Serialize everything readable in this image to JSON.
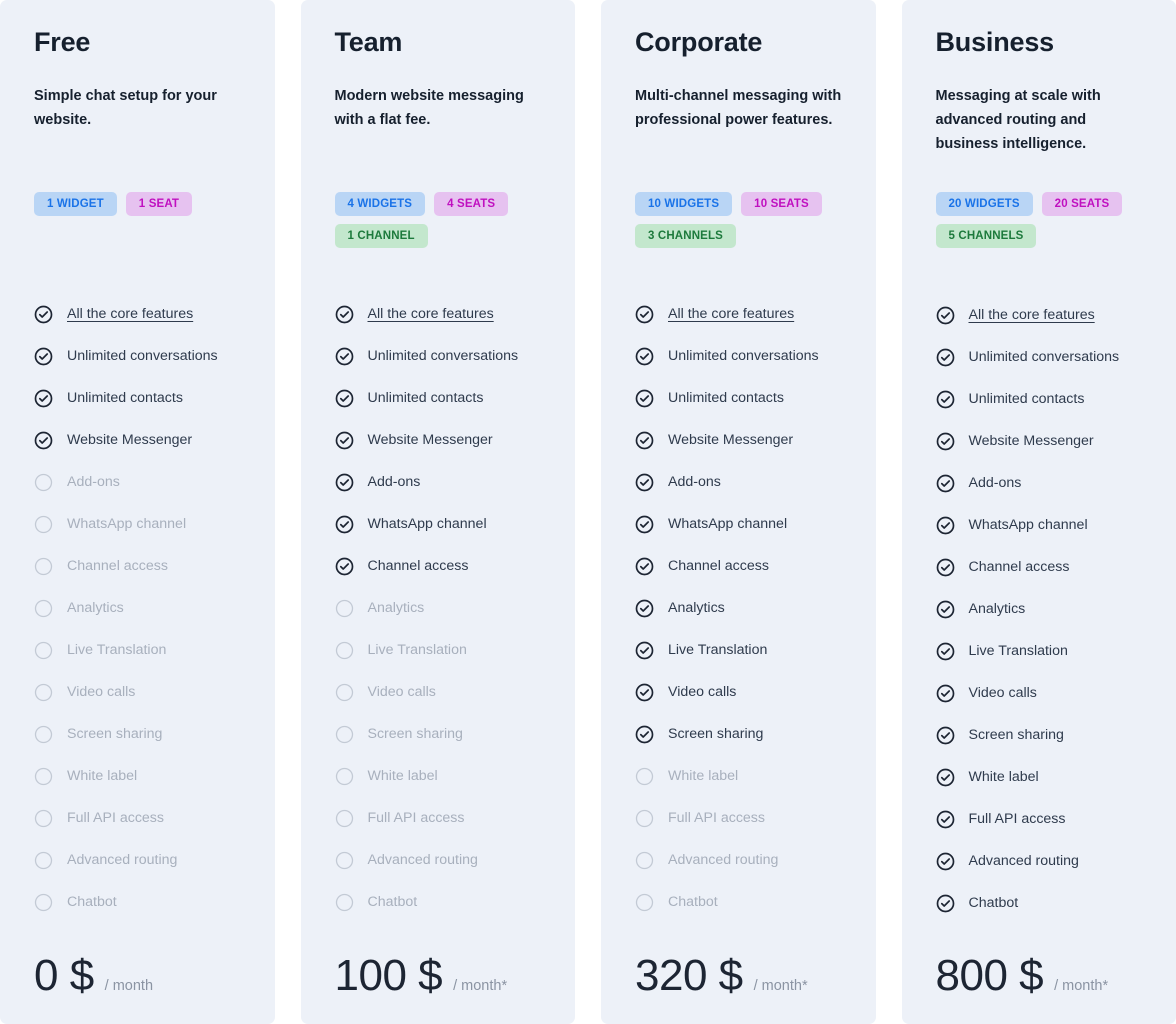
{
  "features": [
    "All the core features",
    "Unlimited conversations",
    "Unlimited contacts",
    "Website Messenger",
    "Add-ons",
    "WhatsApp channel",
    "Channel access",
    "Analytics",
    "Live Translation",
    "Video calls",
    "Screen sharing",
    "White label",
    "Full API access",
    "Advanced routing",
    "Chatbot"
  ],
  "colors": {
    "card_background": "#edf1f8",
    "page_background": "#ffffff",
    "heading": "#16202e",
    "feature_on": "#2f3b4d",
    "feature_off": "#a8b0bd",
    "badge_widgets_bg": "#b9d5f5",
    "badge_widgets_text": "#1a73e8",
    "badge_seats_bg": "#e6c2f0",
    "badge_seats_text": "#c010c0",
    "badge_channels_bg": "#c3e7cd",
    "badge_channels_text": "#1d7a3c",
    "price_amount": "#1d2533",
    "price_period": "#8b94a3"
  },
  "plans": [
    {
      "name": "Free",
      "description": "Simple chat setup for your website.",
      "badges": [
        {
          "label": "1 WIDGET",
          "type": "widgets"
        },
        {
          "label": "1 SEAT",
          "type": "seats"
        }
      ],
      "features": [
        {
          "label": "All the core features",
          "included": true,
          "link": true
        },
        {
          "label": "Unlimited conversations",
          "included": true,
          "link": false
        },
        {
          "label": "Unlimited contacts",
          "included": true,
          "link": false
        },
        {
          "label": "Website Messenger",
          "included": true,
          "link": false
        },
        {
          "label": "Add-ons",
          "included": false,
          "link": false
        },
        {
          "label": "WhatsApp channel",
          "included": false,
          "link": false
        },
        {
          "label": "Channel access",
          "included": false,
          "link": false
        },
        {
          "label": "Analytics",
          "included": false,
          "link": false
        },
        {
          "label": "Live Translation",
          "included": false,
          "link": false
        },
        {
          "label": "Video calls",
          "included": false,
          "link": false
        },
        {
          "label": "Screen sharing",
          "included": false,
          "link": false
        },
        {
          "label": "White label",
          "included": false,
          "link": false
        },
        {
          "label": "Full API access",
          "included": false,
          "link": false
        },
        {
          "label": "Advanced routing",
          "included": false,
          "link": false
        },
        {
          "label": "Chatbot",
          "included": false,
          "link": false
        }
      ],
      "price_amount": "0 $",
      "price_period": "/ month"
    },
    {
      "name": "Team",
      "description": "Modern website messaging with a flat fee.",
      "badges": [
        {
          "label": "4 WIDGETS",
          "type": "widgets"
        },
        {
          "label": "4 SEATS",
          "type": "seats"
        },
        {
          "label": "1 CHANNEL",
          "type": "channels"
        }
      ],
      "features": [
        {
          "label": "All the core features",
          "included": true,
          "link": true
        },
        {
          "label": "Unlimited conversations",
          "included": true,
          "link": false
        },
        {
          "label": "Unlimited contacts",
          "included": true,
          "link": false
        },
        {
          "label": "Website Messenger",
          "included": true,
          "link": false
        },
        {
          "label": "Add-ons",
          "included": true,
          "link": false
        },
        {
          "label": "WhatsApp channel",
          "included": true,
          "link": false
        },
        {
          "label": "Channel access",
          "included": true,
          "link": false
        },
        {
          "label": "Analytics",
          "included": false,
          "link": false
        },
        {
          "label": "Live Translation",
          "included": false,
          "link": false
        },
        {
          "label": "Video calls",
          "included": false,
          "link": false
        },
        {
          "label": "Screen sharing",
          "included": false,
          "link": false
        },
        {
          "label": "White label",
          "included": false,
          "link": false
        },
        {
          "label": "Full API access",
          "included": false,
          "link": false
        },
        {
          "label": "Advanced routing",
          "included": false,
          "link": false
        },
        {
          "label": "Chatbot",
          "included": false,
          "link": false
        }
      ],
      "price_amount": "100 $",
      "price_period": "/ month*"
    },
    {
      "name": "Corporate",
      "description": "Multi-channel messaging with professional power features.",
      "badges": [
        {
          "label": "10 WIDGETS",
          "type": "widgets"
        },
        {
          "label": "10 SEATS",
          "type": "seats"
        },
        {
          "label": "3 CHANNELS",
          "type": "channels"
        }
      ],
      "features": [
        {
          "label": "All the core features",
          "included": true,
          "link": true
        },
        {
          "label": "Unlimited conversations",
          "included": true,
          "link": false
        },
        {
          "label": "Unlimited contacts",
          "included": true,
          "link": false
        },
        {
          "label": "Website Messenger",
          "included": true,
          "link": false
        },
        {
          "label": "Add-ons",
          "included": true,
          "link": false
        },
        {
          "label": "WhatsApp channel",
          "included": true,
          "link": false
        },
        {
          "label": "Channel access",
          "included": true,
          "link": false
        },
        {
          "label": "Analytics",
          "included": true,
          "link": false
        },
        {
          "label": "Live Translation",
          "included": true,
          "link": false
        },
        {
          "label": "Video calls",
          "included": true,
          "link": false
        },
        {
          "label": "Screen sharing",
          "included": true,
          "link": false
        },
        {
          "label": "White label",
          "included": false,
          "link": false
        },
        {
          "label": "Full API access",
          "included": false,
          "link": false
        },
        {
          "label": "Advanced routing",
          "included": false,
          "link": false
        },
        {
          "label": "Chatbot",
          "included": false,
          "link": false
        }
      ],
      "price_amount": "320 $",
      "price_period": "/ month*"
    },
    {
      "name": "Business",
      "description": "Messaging at scale with advanced routing and business intelligence.",
      "badges": [
        {
          "label": "20 WIDGETS",
          "type": "widgets"
        },
        {
          "label": "20 SEATS",
          "type": "seats"
        },
        {
          "label": "5 CHANNELS",
          "type": "channels"
        }
      ],
      "features": [
        {
          "label": "All the core features",
          "included": true,
          "link": true
        },
        {
          "label": "Unlimited conversations",
          "included": true,
          "link": false
        },
        {
          "label": "Unlimited contacts",
          "included": true,
          "link": false
        },
        {
          "label": "Website Messenger",
          "included": true,
          "link": false
        },
        {
          "label": "Add-ons",
          "included": true,
          "link": false
        },
        {
          "label": "WhatsApp channel",
          "included": true,
          "link": false
        },
        {
          "label": "Channel access",
          "included": true,
          "link": false
        },
        {
          "label": "Analytics",
          "included": true,
          "link": false
        },
        {
          "label": "Live Translation",
          "included": true,
          "link": false
        },
        {
          "label": "Video calls",
          "included": true,
          "link": false
        },
        {
          "label": "Screen sharing",
          "included": true,
          "link": false
        },
        {
          "label": "White label",
          "included": true,
          "link": false
        },
        {
          "label": "Full API access",
          "included": true,
          "link": false
        },
        {
          "label": "Advanced routing",
          "included": true,
          "link": false
        },
        {
          "label": "Chatbot",
          "included": true,
          "link": false
        }
      ],
      "price_amount": "800 $",
      "price_period": "/ month*"
    }
  ]
}
